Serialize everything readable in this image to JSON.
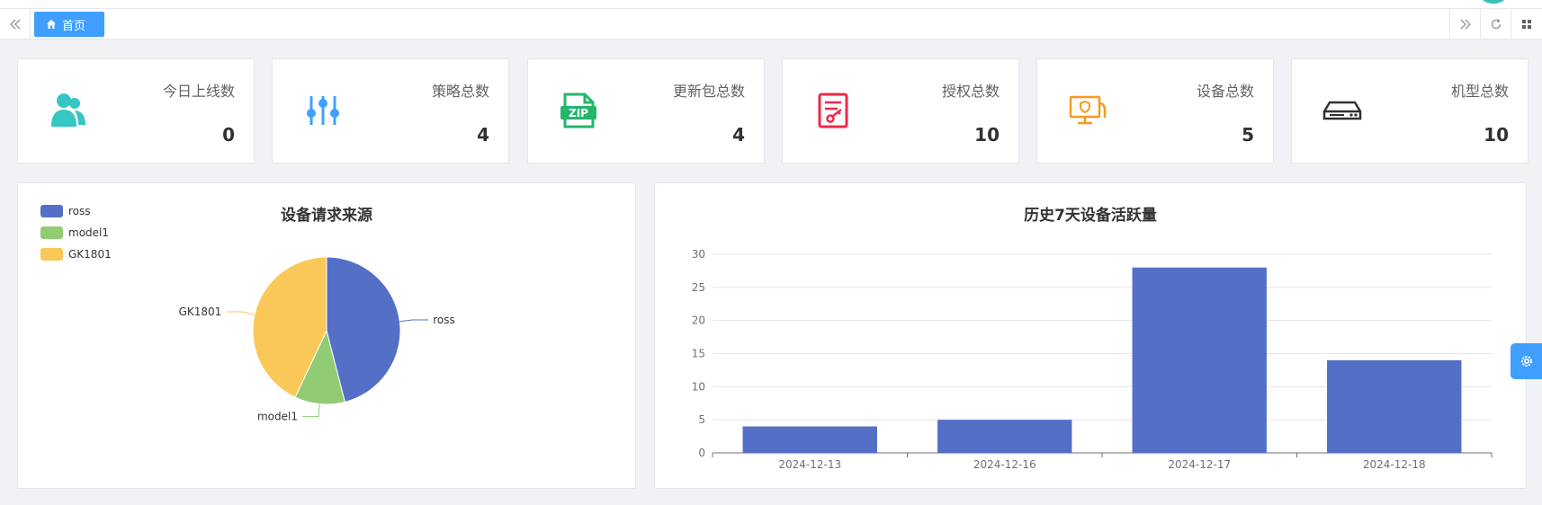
{
  "tabs": {
    "home_label": "首页"
  },
  "stats": [
    {
      "label": "今日上线数",
      "value": "0",
      "icon": "users-icon",
      "color": "#36c6c4"
    },
    {
      "label": "策略总数",
      "value": "4",
      "icon": "sliders-icon",
      "color": "#40a0ff"
    },
    {
      "label": "更新包总数",
      "value": "4",
      "icon": "zip-file-icon",
      "color": "#23b66d"
    },
    {
      "label": "授权总数",
      "value": "10",
      "icon": "license-icon",
      "color": "#f0284a"
    },
    {
      "label": "设备总数",
      "value": "5",
      "icon": "monitor-icon",
      "color": "#f79a1f"
    },
    {
      "label": "机型总数",
      "value": "10",
      "icon": "server-icon",
      "color": "#303133"
    }
  ],
  "pie_panel": {
    "title": "设备请求来源"
  },
  "bar_panel": {
    "title": "历史7天设备活跃量"
  },
  "chart_data": [
    {
      "type": "pie",
      "title": "设备请求来源",
      "legend_position": "top-left",
      "slices": [
        {
          "name": "ross",
          "value": 46,
          "color": "#5470c6"
        },
        {
          "name": "model1",
          "value": 11,
          "color": "#91cc75"
        },
        {
          "name": "GK1801",
          "value": 43,
          "color": "#fac858"
        }
      ]
    },
    {
      "type": "bar",
      "title": "历史7天设备活跃量",
      "categories": [
        "2024-12-13",
        "2024-12-16",
        "2024-12-17",
        "2024-12-18"
      ],
      "values": [
        4,
        5,
        28,
        14
      ],
      "ylim": [
        0,
        30
      ],
      "yticks": [
        0,
        5,
        10,
        15,
        20,
        25,
        30
      ],
      "grid": true,
      "color": "#5470c6"
    }
  ]
}
